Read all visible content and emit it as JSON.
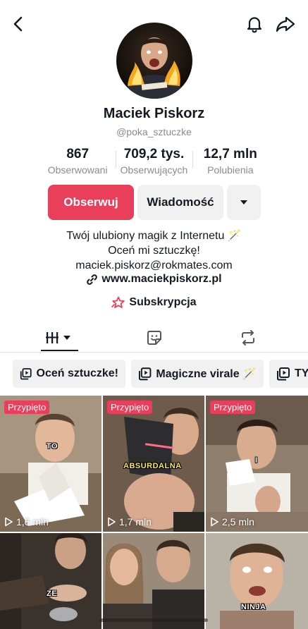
{
  "profile": {
    "name": "Maciek Piskorz",
    "handle": "@poka_sztuczke",
    "stats": [
      {
        "value": "867",
        "label": "Obserwowani"
      },
      {
        "value": "709,2 tys.",
        "label": "Obserwujących"
      },
      {
        "value": "12,7 mln",
        "label": "Polubienia"
      }
    ],
    "follow_label": "Obserwuj",
    "message_label": "Wiadomość",
    "bio_lines": [
      "Twój ulubiony magik z Internetu 🪄",
      "Oceń mi sztuczkę!",
      "maciek.piskorz@rokmates.com"
    ],
    "link": "www.maciekpiskorz.pl",
    "subscription_label": "Subskrypcja"
  },
  "playlists": [
    {
      "label": "Oceń sztuczke!"
    },
    {
      "label": "Magiczne virale 🪄"
    },
    {
      "label": "TY"
    }
  ],
  "videos": [
    {
      "pinned": "Przypięto",
      "views": "1,6 mln",
      "caption": "TO"
    },
    {
      "pinned": "Przypięto",
      "views": "1,7 mln",
      "caption": "ABSURDALNA"
    },
    {
      "pinned": "Przypięto",
      "views": "2,5 mln",
      "caption": "I"
    },
    {
      "caption": "ZE"
    },
    {
      "caption": ""
    },
    {
      "caption": "NINJA"
    }
  ],
  "colors": {
    "accent": "#ea3f5b",
    "text": "#161823",
    "muted": "#8a8b91",
    "button_bg": "#f1f1f2"
  }
}
